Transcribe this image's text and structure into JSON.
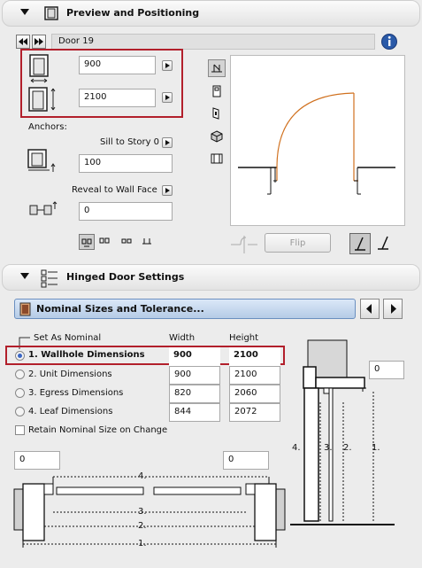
{
  "preview": {
    "header_title": "Preview and Positioning",
    "door_name": "Door 19",
    "width_value": "900",
    "height_value": "2100",
    "anchors_label": "Anchors:",
    "sill_label": "Sill to Story 0",
    "sill_value": "100",
    "reveal_label": "Reveal to Wall Face",
    "reveal_value": "0",
    "flip_label": "Flip"
  },
  "settings": {
    "header_title": "Hinged Door Settings",
    "page_select": "Nominal Sizes and Tolerance...",
    "set_as_nominal_label": "Set As Nominal",
    "width_col": "Width",
    "height_col": "Height",
    "rows": [
      {
        "label": "1. Wallhole Dimensions",
        "width": "900",
        "height": "2100",
        "selected": true
      },
      {
        "label": "2. Unit Dimensions",
        "width": "900",
        "height": "2100",
        "selected": false
      },
      {
        "label": "3. Egress Dimensions",
        "width": "820",
        "height": "2060",
        "selected": false
      },
      {
        "label": "4. Leaf Dimensions",
        "width": "844",
        "height": "2072",
        "selected": false
      }
    ],
    "retain_label": "Retain Nominal Size on Change",
    "right_tol_value": "0",
    "left_tol_value": "0",
    "right_tol2_value": "0",
    "plan_labels": [
      "4.",
      "3.",
      "2.",
      "1."
    ],
    "section_labels": [
      "4.",
      "3.",
      "2.",
      "1."
    ]
  },
  "colors": {
    "accent_red": "#b21f2b",
    "arc_orange": "#d0701e",
    "info_blue": "#2a5aa8"
  }
}
